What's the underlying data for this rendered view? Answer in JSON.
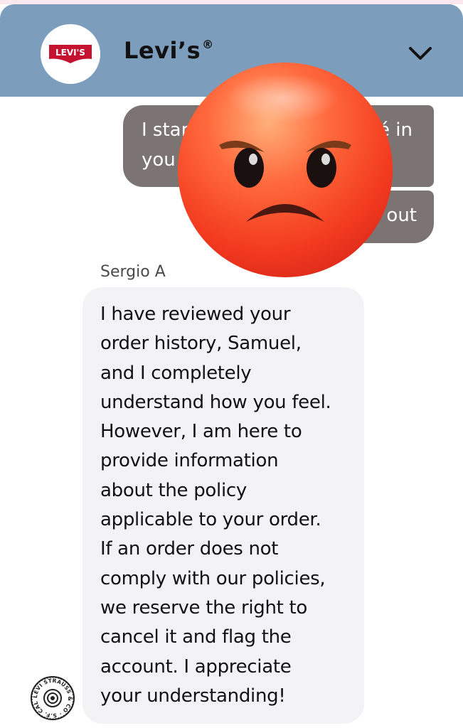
{
  "header": {
    "logo_text": "LEVI'S",
    "brand_name": "Levi’s",
    "registered_mark": "®",
    "menu_icon": "chevron-down-icon",
    "background_color": "#7d9dbd"
  },
  "messages": {
    "outgoing": {
      "line1_left": "I star",
      "line1_right": "é in",
      "line2_left": "you",
      "line3_right": "out",
      "bubble_color": "#7c7473"
    },
    "overlay_icon": "angry-face-emoji",
    "agent": {
      "name": "Sergio A",
      "text": "I have reviewed your\norder history, Samuel,\nand I completely\nunderstand how you feel.\nHowever, I am here to\nprovide information\nabout the policy\napplicable to your order.\nIf an order does not\ncomply with our policies,\nwe reserve the right to\ncancel it and flag the\naccount. I appreciate\nyour understanding!",
      "avatar_icon": "levi-strauss-seal-icon",
      "avatar_text": "LEVI STRAUSS & CO · S.F. CAL ·",
      "bubble_color": "#f3f3f5"
    }
  }
}
